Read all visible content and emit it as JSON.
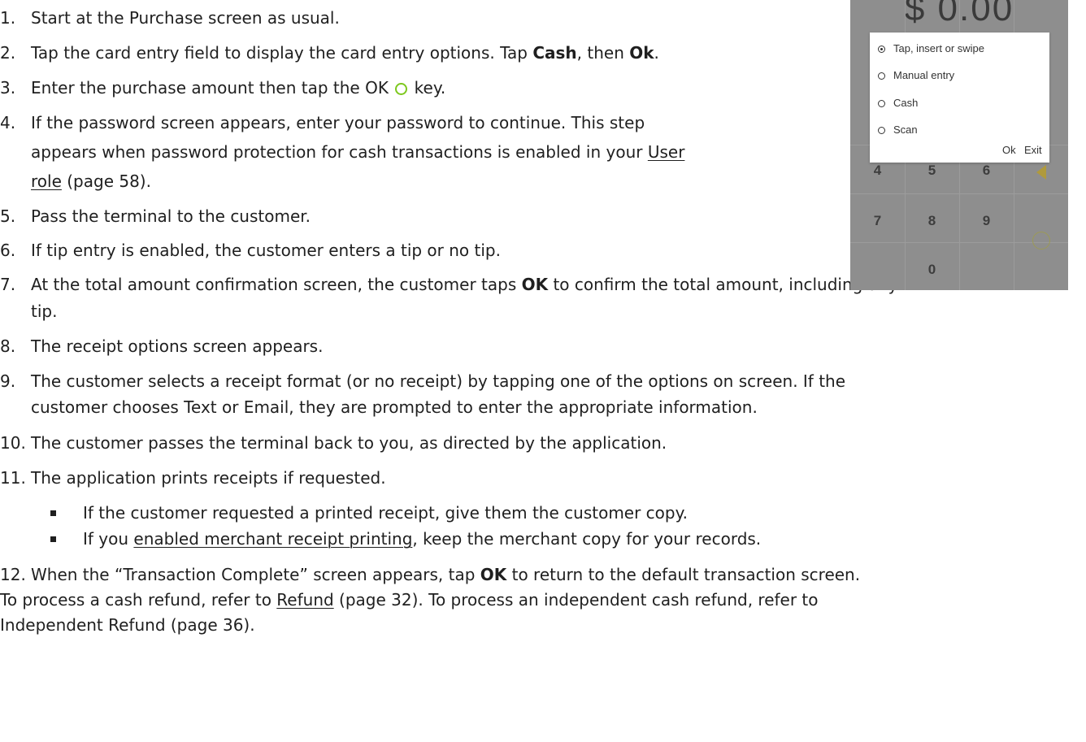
{
  "steps": [
    {
      "num": "1.",
      "text": "Start at the Purchase screen as usual."
    },
    {
      "num": "2.",
      "a": "Tap the card entry field to display the card entry options.  Tap ",
      "b1": "Cash",
      "c": ", then ",
      "b2": "Ok",
      "d": "."
    },
    {
      "num": "3.",
      "a": "Enter the purchase amount then tap the OK ",
      "b": " key."
    },
    {
      "num": "4.",
      "line1": "If the password screen appears, enter your password to continue. This step",
      "line2a": "appears when password protection for cash transactions is enabled in your ",
      "link1": "User",
      "link2": "role",
      "line3b": " (page 58)."
    },
    {
      "num": "5.",
      "text": "Pass the terminal to the customer."
    },
    {
      "num": "6.",
      "text": "If tip entry is enabled, the customer enters a tip or no tip."
    },
    {
      "num": "7.",
      "a": "At the total amount confirmation screen, the customer taps ",
      "b": "OK",
      "c": " to confirm the total amount, including any",
      "line2": "tip."
    },
    {
      "num": "8.",
      "text": "The receipt options screen appears."
    },
    {
      "num": "9.",
      "line1": "The customer selects a receipt format (or no receipt) by tapping one of the options on screen. If the",
      "line2": "customer chooses Text or Email, they are prompted to enter the appropriate information."
    },
    {
      "num": "10.",
      "text": "The customer passes the terminal back to you, as directed by the application."
    },
    {
      "num": "11.",
      "text": "The application prints receipts if requested."
    },
    {
      "num": "12.",
      "a": "When the “Transaction Complete” screen appears, tap ",
      "b": "OK",
      "c": " to return to the default transaction screen."
    }
  ],
  "bullets": [
    {
      "text": "If the customer requested a printed receipt, give them the customer copy."
    },
    {
      "a": "If you ",
      "link": "enabled merchant receipt printing",
      "c": ", keep the merchant copy for your records."
    }
  ],
  "footer": {
    "a": "To process a cash refund, refer to ",
    "link": "Refund",
    "b": " (page 32).  To process an independent cash refund, refer to",
    "line2": "Independent Refund (page 36)."
  },
  "terminal": {
    "amount": "$ 0.00",
    "options": [
      {
        "label": "Tap, insert or swipe",
        "selected": true
      },
      {
        "label": "Manual entry",
        "selected": false
      },
      {
        "label": "Cash",
        "selected": false
      },
      {
        "label": "Scan",
        "selected": false
      }
    ],
    "ok_label": "Ok",
    "exit_label": "Exit",
    "keys": [
      "4",
      "5",
      "6",
      "7",
      "8",
      "9",
      "0"
    ],
    "accent_color": "#7dc81e"
  }
}
